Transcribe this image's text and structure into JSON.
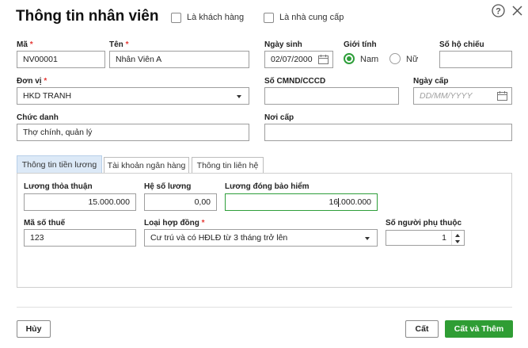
{
  "dialog": {
    "title": "Thông tin nhân viên",
    "is_customer_label": "Là khách hàng",
    "is_supplier_label": "Là nhà cung cấp"
  },
  "form": {
    "code": {
      "label": "Mã",
      "value": "NV00001"
    },
    "name": {
      "label": "Tên",
      "value": "Nhân Viên A"
    },
    "dob": {
      "label": "Ngày sinh",
      "value": "02/07/2000"
    },
    "gender": {
      "label": "Giới tính",
      "male": "Nam",
      "female": "Nữ",
      "selected": "Nam"
    },
    "passport": {
      "label": "Số hộ chiếu",
      "value": ""
    },
    "unit": {
      "label": "Đơn vị",
      "value": "HKD TRANH"
    },
    "id_number": {
      "label": "Số CMND/CCCD",
      "value": ""
    },
    "issue_date": {
      "label": "Ngày cấp",
      "placeholder": "DD/MM/YYYY"
    },
    "position": {
      "label": "Chức danh",
      "value": "Thợ chính, quản lý"
    },
    "issue_place": {
      "label": "Nơi cấp",
      "value": ""
    }
  },
  "tabs": [
    {
      "label": "Thông tin tiền lương",
      "active": true
    },
    {
      "label": "Tài khoản ngân hàng",
      "active": false
    },
    {
      "label": "Thông tin liên hệ",
      "active": false
    }
  ],
  "salary": {
    "agreed_salary": {
      "label": "Lương thỏa thuận",
      "value": "15.000.000"
    },
    "coefficient": {
      "label": "Hệ số lương",
      "value": "0,00"
    },
    "insurance_salary": {
      "label": "Lương đóng bảo hiểm",
      "value_before_cursor": "16",
      "value_after_cursor": ".000.000"
    },
    "tax_code": {
      "label": "Mã số thuế",
      "value": "123"
    },
    "contract_type": {
      "label": "Loại hợp đồng",
      "value": "Cư trú và có HĐLĐ từ 3 tháng trở lên"
    },
    "dependents": {
      "label": "Số người phụ thuộc",
      "value": "1"
    }
  },
  "footer": {
    "cancel_label": "Hủy",
    "save_label": "Cất",
    "save_add_label": "Cất và Thêm"
  },
  "colors": {
    "accent": "#2f9d34",
    "required": "#e53935",
    "active_tab": "#dce9f7"
  },
  "icons": [
    "help-icon",
    "close-icon",
    "calendar-icon",
    "chevron-down-icon"
  ]
}
